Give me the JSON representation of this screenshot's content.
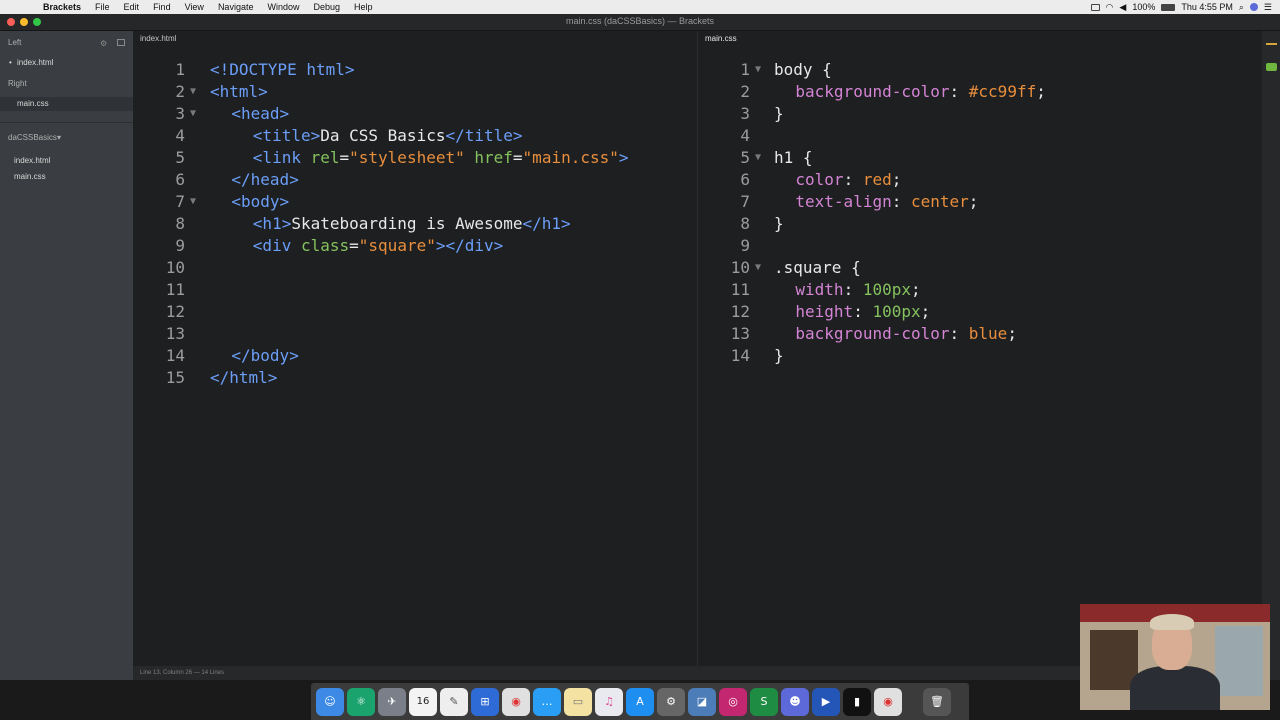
{
  "menubar": {
    "app": "Brackets",
    "items": [
      "File",
      "Edit",
      "Find",
      "View",
      "Navigate",
      "Window",
      "Debug",
      "Help"
    ],
    "battery": "100%",
    "clock": "Thu 4:55 PM"
  },
  "window": {
    "title": "main.css (daCSSBasics) — Brackets"
  },
  "sidebar": {
    "left_label": "Left",
    "left_files": [
      "index.html"
    ],
    "right_label": "Right",
    "right_files": [
      "main.css"
    ],
    "project": "daCSSBasics",
    "project_files": [
      "index.html",
      "main.css"
    ]
  },
  "left_pane": {
    "tab": "index.html"
  },
  "right_pane": {
    "tab": "main.css"
  },
  "statusbar": {
    "text": "Line 13, Column 26 — 14 Lines"
  },
  "dock": {
    "calendar_day": "16"
  },
  "colors": {
    "tag": "#6c9ef8",
    "attribute": "#85c15d",
    "string": "#e88e3d",
    "property": "#d484d4",
    "editor_bg": "#1d1f21",
    "sidebar_bg": "#3a3d41"
  },
  "html_code": [
    {
      "n": "1",
      "fold": false,
      "indent": 0,
      "tokens": [
        [
          "tag",
          "<!DOCTYPE html>"
        ]
      ]
    },
    {
      "n": "2",
      "fold": true,
      "indent": 0,
      "tokens": [
        [
          "tag",
          "<html>"
        ]
      ]
    },
    {
      "n": "3",
      "fold": true,
      "indent": 2,
      "tokens": [
        [
          "tag",
          "<head>"
        ]
      ]
    },
    {
      "n": "4",
      "fold": false,
      "indent": 4,
      "tokens": [
        [
          "tag",
          "<title>"
        ],
        [
          "txt",
          "Da CSS Basics"
        ],
        [
          "tag",
          "</title>"
        ]
      ]
    },
    {
      "n": "5",
      "fold": false,
      "indent": 4,
      "tokens": [
        [
          "tag",
          "<link "
        ],
        [
          "attr",
          "rel"
        ],
        [
          "txt",
          "="
        ],
        [
          "str",
          "\"stylesheet\""
        ],
        [
          "txt",
          " "
        ],
        [
          "attr",
          "href"
        ],
        [
          "txt",
          "="
        ],
        [
          "str",
          "\"main.css\""
        ],
        [
          "tag",
          ">"
        ]
      ]
    },
    {
      "n": "6",
      "fold": false,
      "indent": 2,
      "tokens": [
        [
          "tag",
          "</head>"
        ]
      ]
    },
    {
      "n": "7",
      "fold": true,
      "indent": 2,
      "tokens": [
        [
          "tag",
          "<body>"
        ]
      ]
    },
    {
      "n": "8",
      "fold": false,
      "indent": 4,
      "tokens": [
        [
          "tag",
          "<h1>"
        ],
        [
          "txt",
          "Skateboarding is Awesome"
        ],
        [
          "tag",
          "</h1>"
        ]
      ]
    },
    {
      "n": "9",
      "fold": false,
      "indent": 4,
      "tokens": [
        [
          "tag",
          "<div "
        ],
        [
          "attr",
          "class"
        ],
        [
          "txt",
          "="
        ],
        [
          "str",
          "\"square\""
        ],
        [
          "tag",
          "></div>"
        ]
      ]
    },
    {
      "n": "10",
      "fold": false,
      "indent": 0,
      "tokens": []
    },
    {
      "n": "11",
      "fold": false,
      "indent": 0,
      "tokens": []
    },
    {
      "n": "12",
      "fold": false,
      "indent": 0,
      "tokens": []
    },
    {
      "n": "13",
      "fold": false,
      "indent": 0,
      "tokens": []
    },
    {
      "n": "14",
      "fold": false,
      "indent": 2,
      "tokens": [
        [
          "tag",
          "</body>"
        ]
      ]
    },
    {
      "n": "15",
      "fold": false,
      "indent": 0,
      "tokens": [
        [
          "tag",
          "</html>"
        ]
      ]
    }
  ],
  "css_code": [
    {
      "n": "1",
      "fold": true,
      "indent": 0,
      "tokens": [
        [
          "sel",
          "body "
        ],
        [
          "punc",
          "{"
        ]
      ]
    },
    {
      "n": "2",
      "fold": false,
      "indent": 2,
      "tokens": [
        [
          "prop",
          "background-color"
        ],
        [
          "punc",
          ": "
        ],
        [
          "val",
          "#cc99ff"
        ],
        [
          "punc",
          ";"
        ]
      ]
    },
    {
      "n": "3",
      "fold": false,
      "indent": 0,
      "tokens": [
        [
          "punc",
          "}"
        ]
      ]
    },
    {
      "n": "4",
      "fold": false,
      "indent": 0,
      "tokens": []
    },
    {
      "n": "5",
      "fold": true,
      "indent": 0,
      "tokens": [
        [
          "sel",
          "h1 "
        ],
        [
          "punc",
          "{"
        ]
      ]
    },
    {
      "n": "6",
      "fold": false,
      "indent": 2,
      "tokens": [
        [
          "prop",
          "color"
        ],
        [
          "punc",
          ": "
        ],
        [
          "val",
          "red"
        ],
        [
          "punc",
          ";"
        ]
      ]
    },
    {
      "n": "7",
      "fold": false,
      "indent": 2,
      "tokens": [
        [
          "prop",
          "text-align"
        ],
        [
          "punc",
          ": "
        ],
        [
          "val",
          "center"
        ],
        [
          "punc",
          ";"
        ]
      ]
    },
    {
      "n": "8",
      "fold": false,
      "indent": 0,
      "tokens": [
        [
          "punc",
          "}"
        ]
      ]
    },
    {
      "n": "9",
      "fold": false,
      "indent": 0,
      "tokens": []
    },
    {
      "n": "10",
      "fold": true,
      "indent": 0,
      "tokens": [
        [
          "sel",
          ".square "
        ],
        [
          "punc",
          "{"
        ]
      ]
    },
    {
      "n": "11",
      "fold": false,
      "indent": 2,
      "tokens": [
        [
          "prop",
          "width"
        ],
        [
          "punc",
          ": "
        ],
        [
          "num",
          "100px"
        ],
        [
          "punc",
          ";"
        ]
      ]
    },
    {
      "n": "12",
      "fold": false,
      "indent": 2,
      "tokens": [
        [
          "prop",
          "height"
        ],
        [
          "punc",
          ": "
        ],
        [
          "num",
          "100px"
        ],
        [
          "punc",
          ";"
        ]
      ]
    },
    {
      "n": "13",
      "fold": false,
      "indent": 2,
      "tokens": [
        [
          "prop",
          "background-color"
        ],
        [
          "punc",
          ": "
        ],
        [
          "val",
          "blue"
        ],
        [
          "punc",
          ";"
        ]
      ]
    },
    {
      "n": "14",
      "fold": false,
      "indent": 0,
      "tokens": [
        [
          "punc",
          "}"
        ]
      ]
    }
  ]
}
